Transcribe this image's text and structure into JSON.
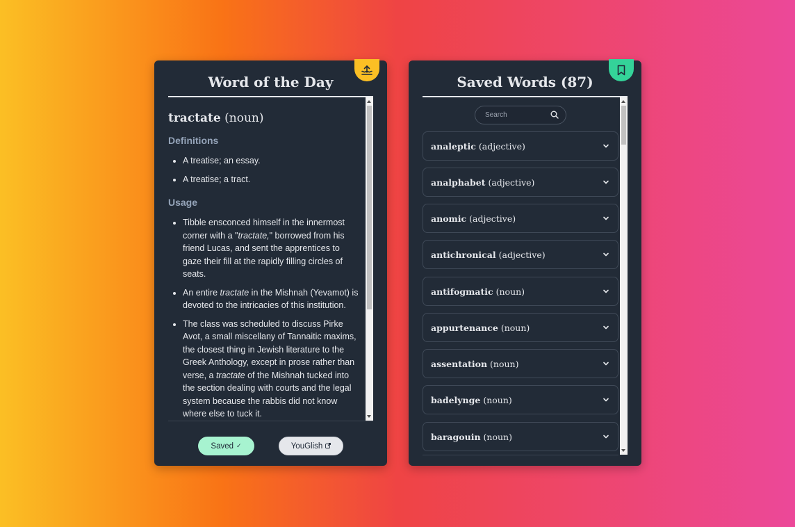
{
  "word_of_day": {
    "title": "Word of the Day",
    "word": "tractate",
    "pos": "(noun)",
    "definitions_title": "Definitions",
    "definitions": [
      "A treatise; an essay.",
      "A treatise; a tract."
    ],
    "usage_title": "Usage",
    "usage": [
      {
        "before": "Tibble ensconced himself in the innermost corner with a \"",
        "em": "tractate,",
        "after": "\" borrowed from his friend Lucas, and sent the apprentices to gaze their fill at the rapidly filling circles of seats."
      },
      {
        "before": "An entire ",
        "em": "tractate",
        "after": " in the Mishnah (Yevamot) is devoted to the intricacies of this institution."
      },
      {
        "before": "The class was scheduled to discuss Pirke Avot, a small miscellany of Tannaitic maxims, the closest thing in Jewish literature to the Greek Anthology, except in prose rather than verse, a ",
        "em": "tractate",
        "after": " of the Mishnah tucked into the section dealing with courts and the legal system because the rabbis did not know where else to tuck it."
      }
    ],
    "saved_label": "Saved",
    "saved_icon": "✓",
    "youglish_label": "YouGlish",
    "youglish_icon": "↗",
    "badge_icon": "share-upload-icon",
    "badge_color": "#fbbf24"
  },
  "saved_words": {
    "title": "Saved Words (87)",
    "search_placeholder": "Search",
    "badge_icon": "bookmark-icon",
    "badge_color": "#34d399",
    "items": [
      {
        "word": "analeptic",
        "pos": "(adjective)"
      },
      {
        "word": "analphabet",
        "pos": "(adjective)"
      },
      {
        "word": "anomic",
        "pos": "(adjective)"
      },
      {
        "word": "antichronical",
        "pos": "(adjective)"
      },
      {
        "word": "antifogmatic",
        "pos": "(noun)"
      },
      {
        "word": "appurtenance",
        "pos": "(noun)"
      },
      {
        "word": "assentation",
        "pos": "(noun)"
      },
      {
        "word": "badelynge",
        "pos": "(noun)"
      },
      {
        "word": "baragouin",
        "pos": "(noun)"
      }
    ]
  }
}
